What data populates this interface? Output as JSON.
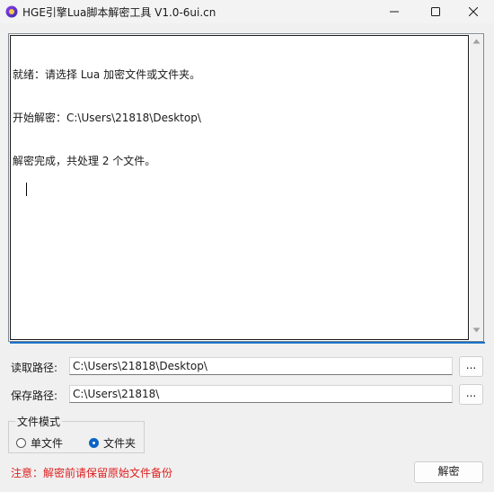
{
  "window": {
    "title": "HGE引擎Lua脚本解密工具 V1.0-6ui.cn",
    "icons": {
      "app": "app-icon",
      "minimize": "minimize-icon",
      "maximize": "maximize-icon",
      "close": "close-icon"
    }
  },
  "log": {
    "lines": [
      "就绪：请选择 Lua 加密文件或文件夹。",
      "开始解密：C:\\Users\\21818\\Desktop\\",
      "解密完成，共处理 2 个文件。"
    ]
  },
  "read_path": {
    "label": "读取路径:",
    "value": "C:\\Users\\21818\\Desktop\\",
    "browse_label": "..."
  },
  "save_path": {
    "label": "保存路径:",
    "value": "C:\\Users\\21818\\",
    "browse_label": "..."
  },
  "mode": {
    "title": "文件模式",
    "options": [
      {
        "label": "单文件",
        "selected": false
      },
      {
        "label": "文件夹",
        "selected": true
      }
    ]
  },
  "footer": {
    "warning": "注意：解密前请保留原始文件备份",
    "decrypt_label": "解密"
  },
  "colors": {
    "warning": "#e02020",
    "accent": "#1a73c9",
    "radio_selected": "#0a64c6"
  }
}
